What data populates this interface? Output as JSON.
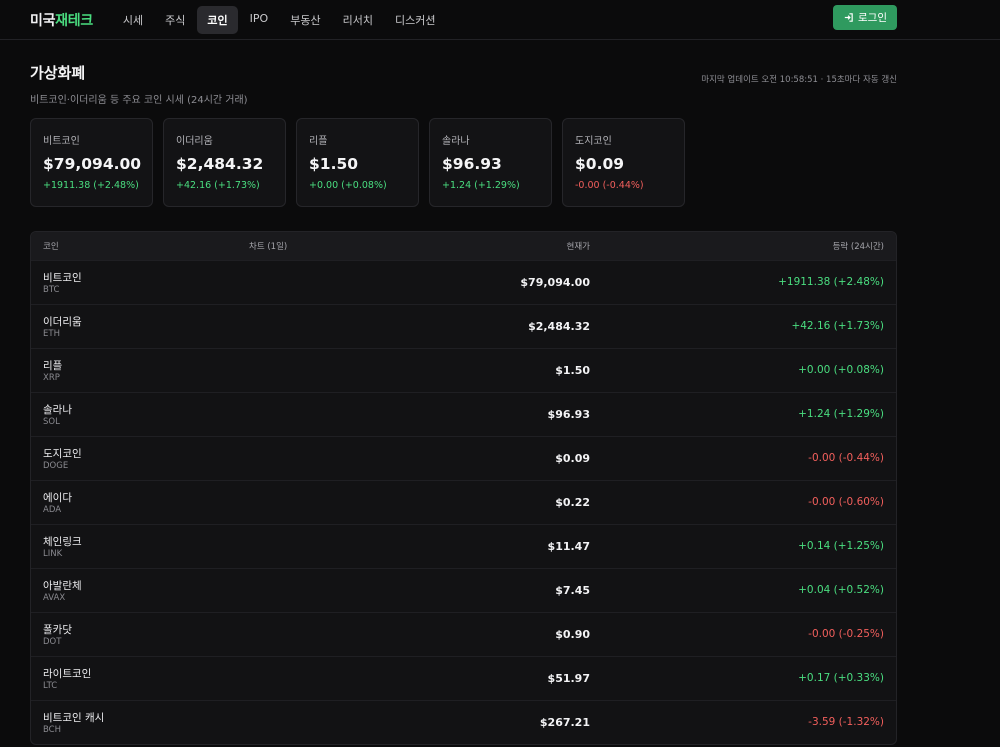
{
  "nav": {
    "logo_part1": "미국",
    "logo_part2": "재테크",
    "items": [
      {
        "label": "시세"
      },
      {
        "label": "주식"
      },
      {
        "label": "코인",
        "active": true
      },
      {
        "label": "IPO"
      },
      {
        "label": "부동산"
      },
      {
        "label": "리서치"
      },
      {
        "label": "디스커션"
      }
    ],
    "login_label": "로그인"
  },
  "header": {
    "title": "가상화폐",
    "subtitle": "비트코인·이더리움 등 주요 코인 시세 (24시간 거래)",
    "update_info": "마지막 업데이트 오전 10:58:51 · 15초마다 자동 갱신"
  },
  "cards": [
    {
      "name": "비트코인",
      "price": "$79,094.00",
      "change": "+1911.38 (+2.48%)",
      "direction": "up"
    },
    {
      "name": "이더리움",
      "price": "$2,484.32",
      "change": "+42.16 (+1.73%)",
      "direction": "up"
    },
    {
      "name": "리플",
      "price": "$1.50",
      "change": "+0.00 (+0.08%)",
      "direction": "up"
    },
    {
      "name": "솔라나",
      "price": "$96.93",
      "change": "+1.24 (+1.29%)",
      "direction": "up"
    },
    {
      "name": "도지코인",
      "price": "$0.09",
      "change": "-0.00 (-0.44%)",
      "direction": "down"
    }
  ],
  "table": {
    "headers": {
      "coin": "코인",
      "chart": "차트 (1일)",
      "price": "현재가",
      "change": "등락 (24시간)"
    },
    "rows": [
      {
        "name": "비트코인",
        "symbol": "BTC",
        "price": "$79,094.00",
        "change": "+1911.38 (+2.48%)",
        "direction": "up"
      },
      {
        "name": "이더리움",
        "symbol": "ETH",
        "price": "$2,484.32",
        "change": "+42.16 (+1.73%)",
        "direction": "up"
      },
      {
        "name": "리플",
        "symbol": "XRP",
        "price": "$1.50",
        "change": "+0.00 (+0.08%)",
        "direction": "up"
      },
      {
        "name": "솔라나",
        "symbol": "SOL",
        "price": "$96.93",
        "change": "+1.24 (+1.29%)",
        "direction": "up"
      },
      {
        "name": "도지코인",
        "symbol": "DOGE",
        "price": "$0.09",
        "change": "-0.00 (-0.44%)",
        "direction": "down"
      },
      {
        "name": "에이다",
        "symbol": "ADA",
        "price": "$0.22",
        "change": "-0.00 (-0.60%)",
        "direction": "down"
      },
      {
        "name": "체인링크",
        "symbol": "LINK",
        "price": "$11.47",
        "change": "+0.14 (+1.25%)",
        "direction": "up"
      },
      {
        "name": "아발란체",
        "symbol": "AVAX",
        "price": "$7.45",
        "change": "+0.04 (+0.52%)",
        "direction": "up"
      },
      {
        "name": "폴카닷",
        "symbol": "DOT",
        "price": "$0.90",
        "change": "-0.00 (-0.25%)",
        "direction": "down"
      },
      {
        "name": "라이트코인",
        "symbol": "LTC",
        "price": "$51.97",
        "change": "+0.17 (+0.33%)",
        "direction": "up"
      },
      {
        "name": "비트코인 캐시",
        "symbol": "BCH",
        "price": "$267.21",
        "change": "-3.59 (-1.32%)",
        "direction": "down"
      }
    ]
  },
  "colors": {
    "up": "#4ade80",
    "down": "#f25f5c",
    "accent": "#2f9a5f"
  },
  "icons": {
    "login": "login-arrow-icon"
  }
}
